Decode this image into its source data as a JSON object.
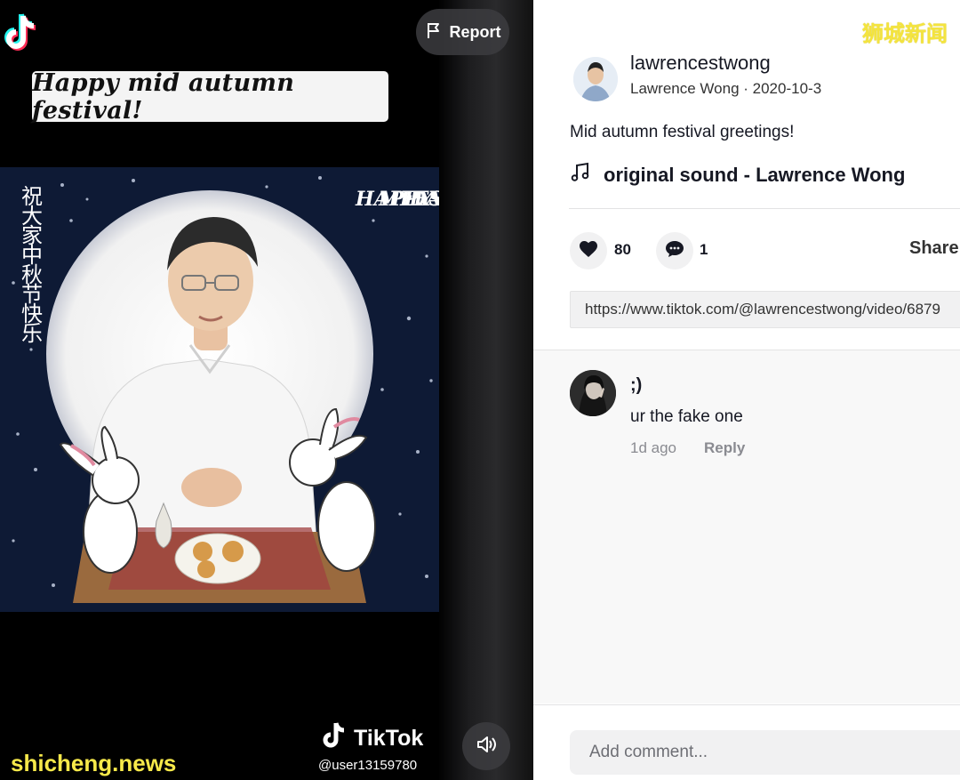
{
  "video": {
    "caption_banner": "Happy mid autumn festival!",
    "report_label": "Report",
    "greeting_cn": "祝大家 中秋节快乐",
    "overlay_en_col1": "HAPPY",
    "overlay_en_col2": "MIDAUTUMN",
    "overlay_en_col3": "FESTIVAL",
    "watermark_brand": "TikTok",
    "watermark_user": "@user13159780",
    "site_watermark": "shicheng.news"
  },
  "icons": {
    "logo": "tiktok-icon",
    "report": "flag-icon",
    "volume": "speaker-icon",
    "music": "music-note-icon",
    "like": "heart-icon",
    "comment": "comment-bubble-icon"
  },
  "colors": {
    "site_watermark": "#f7e94a",
    "news_logo": "#f4e43e",
    "video_background": "#0e1a35"
  },
  "info": {
    "news_logo": "狮城新闻",
    "author": {
      "username": "lawrencestwong",
      "meta": "Lawrence Wong · 2020-10-3"
    },
    "description": "Mid autumn festival greetings!",
    "music": "original sound - Lawrence Wong",
    "likes": "80",
    "comments_count": "1",
    "share_label": "Share",
    "share_link": "https://www.tiktok.com/@lawrencestwong/video/6879"
  },
  "comments": [
    {
      "username": ";)",
      "text": "ur the fake one",
      "time": "1d ago",
      "reply_label": "Reply"
    }
  ],
  "comment_input": {
    "placeholder": "Add comment..."
  }
}
